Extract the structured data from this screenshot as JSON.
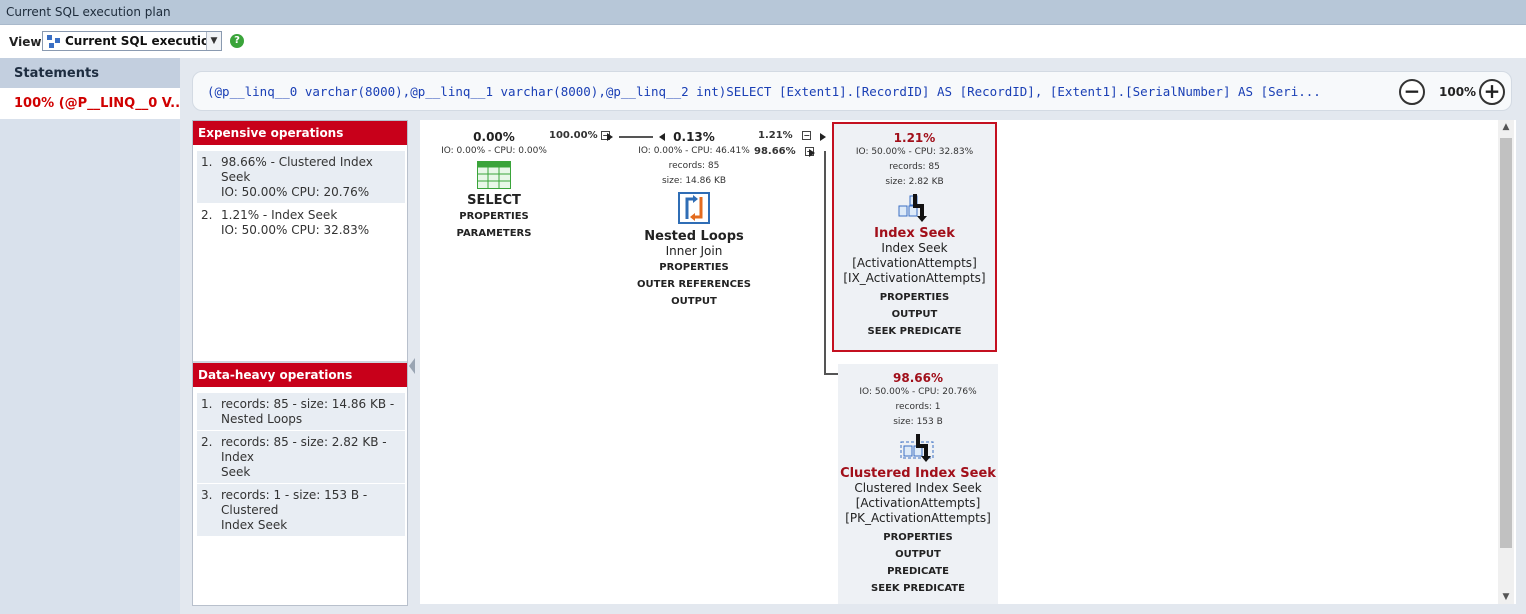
{
  "window": {
    "title": "Current SQL execution plan"
  },
  "viewbar": {
    "label": "View:",
    "selected": "Current SQL execution..."
  },
  "statements": {
    "header": "Statements",
    "items": [
      "100% (@P__LINQ__0 V..."
    ]
  },
  "sql": {
    "text": "(@p__linq__0 varchar(8000),@p__linq__1 varchar(8000),@p__linq__2 int)SELECT  [Extent1].[RecordID] AS [RecordID],  [Extent1].[SerialNumber] AS [Seri...",
    "zoom": "100%"
  },
  "expensive": {
    "title": "Expensive operations",
    "items": [
      {
        "num": "1.",
        "line1": "98.66% - Clustered Index Seek",
        "line2": "IO: 50.00% CPU: 20.76%"
      },
      {
        "num": "2.",
        "line1": "1.21% - Index Seek",
        "line2": "IO: 50.00% CPU: 32.83%"
      }
    ]
  },
  "dataheavy": {
    "title": "Data-heavy operations",
    "items": [
      {
        "num": "1.",
        "line1": "records: 85 - size: 14.86 KB -",
        "line2": "Nested Loops"
      },
      {
        "num": "2.",
        "line1": "records: 85 - size: 2.82 KB - Index",
        "line2": "Seek"
      },
      {
        "num": "3.",
        "line1": "records: 1 - size: 153 B - Clustered",
        "line2": "Index Seek"
      }
    ]
  },
  "plan": {
    "select": {
      "pct": "0.00%",
      "stats": "IO: 0.00% - CPU: 0.00%",
      "name": "SELECT",
      "links": [
        "PROPERTIES",
        "PARAMETERS"
      ]
    },
    "edge1": {
      "label": "100.00%"
    },
    "nested": {
      "pct": "0.13%",
      "stats": "IO: 0.00% - CPU: 46.41%",
      "records": "records: 85",
      "size": "size: 14.86 KB",
      "name": "Nested Loops",
      "sub": "Inner Join",
      "links": [
        "PROPERTIES",
        "OUTER REFERENCES",
        "OUTPUT"
      ]
    },
    "edge2": {
      "label": "1.21%"
    },
    "edge3": {
      "label": "98.66%"
    },
    "indexseek": {
      "pct": "1.21%",
      "stats": "IO: 50.00% - CPU: 32.83%",
      "records": "records: 85",
      "size": "size: 2.82 KB",
      "name": "Index Seek",
      "sub1": "Index Seek",
      "sub2": "[ActivationAttempts]",
      "sub3": "[IX_ActivationAttempts]",
      "links": [
        "PROPERTIES",
        "OUTPUT",
        "SEEK PREDICATE"
      ]
    },
    "clustered": {
      "pct": "98.66%",
      "stats": "IO: 50.00% - CPU: 20.76%",
      "records": "records: 1",
      "size": "size: 153 B",
      "name": "Clustered Index Seek",
      "sub1": "Clustered Index Seek",
      "sub2": "[ActivationAttempts]",
      "sub3": "[PK_ActivationAttempts]",
      "links": [
        "PROPERTIES",
        "OUTPUT",
        "PREDICATE",
        "SEEK PREDICATE"
      ]
    }
  }
}
